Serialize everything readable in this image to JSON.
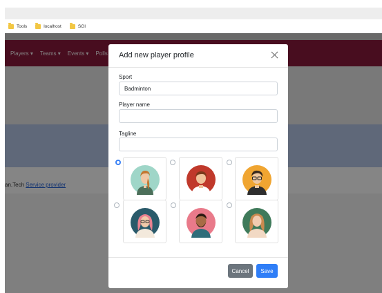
{
  "browser": {
    "bookmarks": [
      "Tools",
      "localhost",
      "SGI"
    ]
  },
  "page": {
    "nav_items": [
      "Players ▾",
      "Teams ▾",
      "Events ▾",
      "Polls"
    ],
    "footer_prefix": "an.Tech",
    "footer_link": "Service provider"
  },
  "modal": {
    "title": "Add new player profile",
    "sport_label": "Sport",
    "sport_value": "Badminton",
    "player_name_label": "Player name",
    "player_name_value": "",
    "tagline_label": "Tagline",
    "tagline_value": "",
    "selected_avatar_index": 0,
    "avatars": [
      "avatar-woman-braid",
      "avatar-man-red-shirt",
      "avatar-man-glasses",
      "avatar-woman-pink-hair",
      "avatar-man-beard",
      "avatar-woman-long-hair"
    ],
    "cancel_label": "Cancel",
    "save_label": "Save"
  },
  "colors": {
    "navbar": "#8b1a3c",
    "primary": "#2f7ef7",
    "secondary": "#6c757d"
  }
}
